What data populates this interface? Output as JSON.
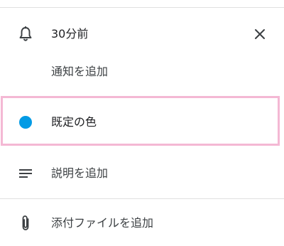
{
  "notification": {
    "time_label": "30分前",
    "add_label": "通知を追加"
  },
  "color": {
    "label": "既定の色",
    "swatch": "#039be5"
  },
  "description": {
    "label": "説明を追加"
  },
  "attachment": {
    "label": "添付ファイルを追加"
  },
  "icons": {
    "bell": "bell-icon",
    "close": "close-icon",
    "notes": "notes-icon",
    "paperclip": "paperclip-icon"
  },
  "colors": {
    "highlight_border": "#f4b8d4",
    "divider": "#e0e0e0",
    "text": "#3c4043"
  }
}
